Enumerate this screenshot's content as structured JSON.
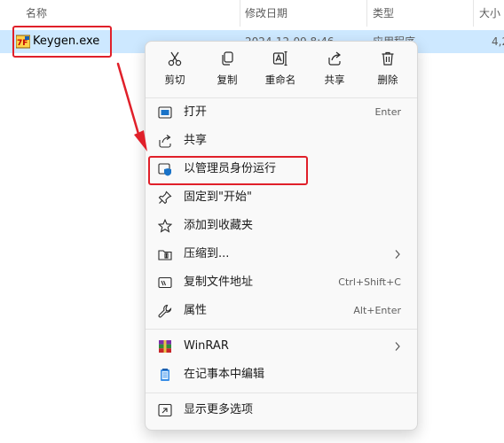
{
  "header": {
    "columns": [
      "名称",
      "修改日期",
      "类型",
      "大小"
    ]
  },
  "file": {
    "name": "Keygen.exe",
    "date": "2024-12-09 8:46",
    "type": "应用程序",
    "size": "4,2"
  },
  "context_menu": {
    "top_actions": [
      {
        "label": "剪切",
        "icon": "cut-icon"
      },
      {
        "label": "复制",
        "icon": "copy-icon"
      },
      {
        "label": "重命名",
        "icon": "rename-icon"
      },
      {
        "label": "共享",
        "icon": "share-icon"
      },
      {
        "label": "删除",
        "icon": "delete-icon"
      }
    ],
    "items": [
      {
        "label": "打开",
        "shortcut": "Enter",
        "icon": "open-app-icon"
      },
      {
        "label": "共享",
        "shortcut": "",
        "icon": "share-icon"
      },
      {
        "label": "以管理员身份运行",
        "shortcut": "",
        "icon": "admin-shield-icon"
      },
      {
        "label": "固定到\"开始\"",
        "shortcut": "",
        "icon": "pin-icon"
      },
      {
        "label": "添加到收藏夹",
        "shortcut": "",
        "icon": "star-icon"
      },
      {
        "label": "压缩到...",
        "shortcut": "",
        "icon": "zip-folder-icon",
        "submenu": true
      },
      {
        "label": "复制文件地址",
        "shortcut": "Ctrl+Shift+C",
        "icon": "copy-path-icon"
      },
      {
        "label": "属性",
        "shortcut": "Alt+Enter",
        "icon": "wrench-icon"
      },
      {
        "label": "WinRAR",
        "shortcut": "",
        "icon": "winrar-icon",
        "submenu": true
      },
      {
        "label": "在记事本中编辑",
        "shortcut": "",
        "icon": "notepad-icon"
      },
      {
        "label": "显示更多选项",
        "shortcut": "",
        "icon": "more-options-icon"
      }
    ]
  },
  "colors": {
    "selection": "#cde8ff",
    "highlight_red": "#e0202a",
    "accent_blue": "#0067c0"
  }
}
